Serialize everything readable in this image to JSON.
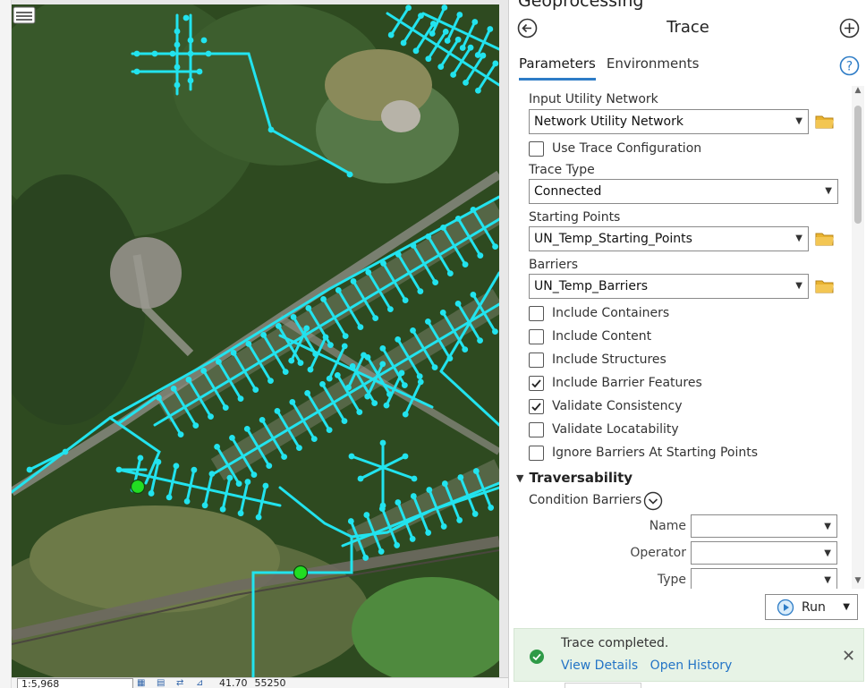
{
  "pane": {
    "title": "Geoprocessing",
    "tool_title": "Trace",
    "tabs": [
      {
        "label": "Parameters",
        "active": true
      },
      {
        "label": "Environments",
        "active": false
      }
    ]
  },
  "params": {
    "input_network": {
      "label": "Input Utility Network",
      "value": "Network Utility Network"
    },
    "use_trace_config": {
      "label": "Use Trace Configuration",
      "checked": false
    },
    "trace_type": {
      "label": "Trace Type",
      "value": "Connected"
    },
    "starting_points": {
      "label": "Starting Points",
      "value": "UN_Temp_Starting_Points"
    },
    "barriers": {
      "label": "Barriers",
      "value": "UN_Temp_Barriers"
    },
    "checkboxes": [
      {
        "label": "Include Containers",
        "checked": false
      },
      {
        "label": "Include Content",
        "checked": false
      },
      {
        "label": "Include Structures",
        "checked": false
      },
      {
        "label": "Include Barrier Features",
        "checked": true
      },
      {
        "label": "Validate Consistency",
        "checked": true
      },
      {
        "label": "Validate Locatability",
        "checked": false
      },
      {
        "label": "Ignore Barriers At Starting Points",
        "checked": false
      }
    ],
    "traversability": {
      "header": "Traversability",
      "condition_barriers": "Condition Barriers",
      "name_label": "Name",
      "operator_label": "Operator",
      "type_label": "Type"
    }
  },
  "run": {
    "label": "Run"
  },
  "message": {
    "text": "Trace completed.",
    "view_details": "View Details",
    "open_history": "Open History"
  },
  "map_status": {
    "scale": "1:5,968",
    "coord": "41.70",
    "count": "55250"
  },
  "colors": {
    "network_line": "#22e3ee",
    "starting_point": "#22dd22",
    "accent": "#2d7cc6",
    "folder": "#e9b330",
    "success_bg": "#e7f3e6"
  },
  "icons": {
    "back": "back-arrow-icon",
    "add": "add-circle-icon",
    "help": "help-icon",
    "folder": "folder-icon",
    "run": "play-icon",
    "success": "check-circle-icon",
    "close": "close-icon",
    "expand": "chevron-down-icon"
  }
}
